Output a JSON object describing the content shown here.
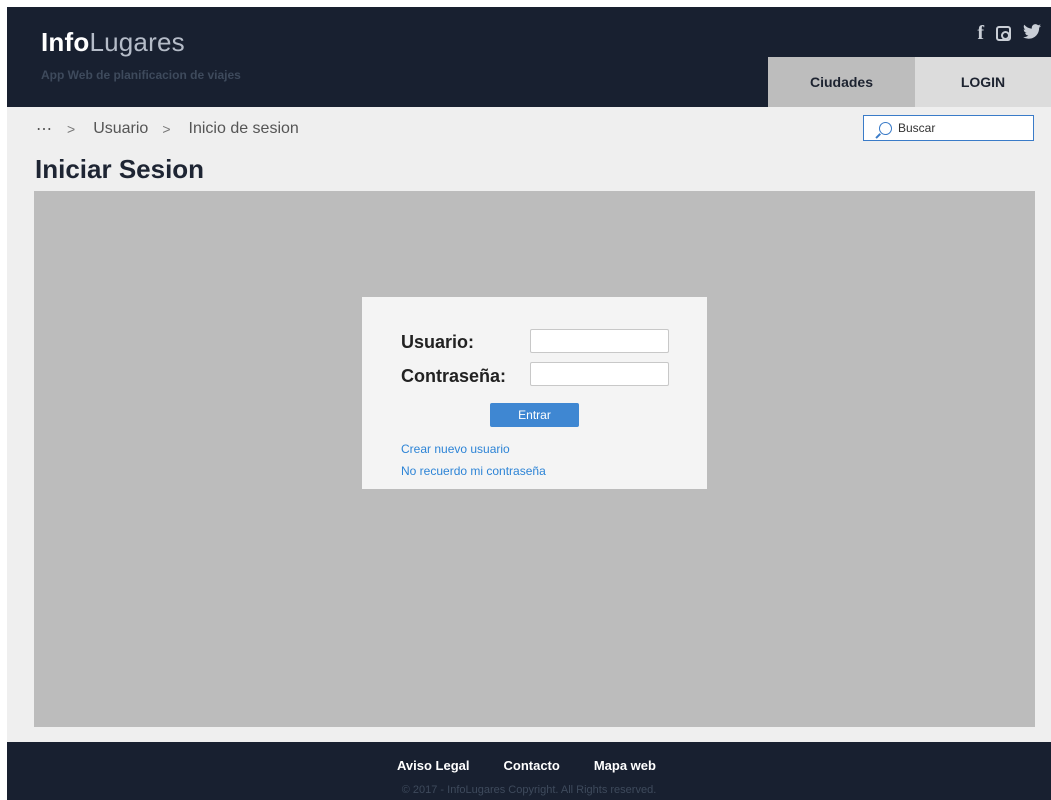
{
  "header": {
    "brand_bold": "Info",
    "brand_light": "Lugares",
    "tagline": "App Web de planificacion de viajes",
    "social": [
      {
        "icon": "facebook-icon",
        "glyph": "f"
      },
      {
        "icon": "instagram-icon"
      },
      {
        "icon": "twitter-icon",
        "glyph": "❦"
      }
    ],
    "nav": {
      "cities": "Ciudades",
      "login": "LOGIN"
    }
  },
  "breadcrumb": {
    "more": "⋯",
    "sep": ">",
    "items": [
      "Usuario",
      "Inicio de sesion"
    ]
  },
  "search": {
    "placeholder": "Buscar"
  },
  "page_title": "Iniciar Sesion",
  "login_form": {
    "user_label": "Usuario:",
    "password_label": "Contraseña:",
    "user_value": "",
    "password_value": "",
    "submit_label": "Entrar",
    "create_user_link": "Crear nuevo usuario",
    "forgot_password_link": "No recuerdo mi contraseña"
  },
  "footer": {
    "links": [
      "Aviso Legal",
      "Contacto",
      "Mapa web"
    ],
    "copyright": "© 2017 - InfoLugares Copyright. All Rights reserved."
  },
  "colors": {
    "header_bg": "#182030",
    "page_bg": "#efefef",
    "content_bg": "#bcbcbc",
    "accent": "#3f87d2",
    "link": "#2d84d6"
  }
}
